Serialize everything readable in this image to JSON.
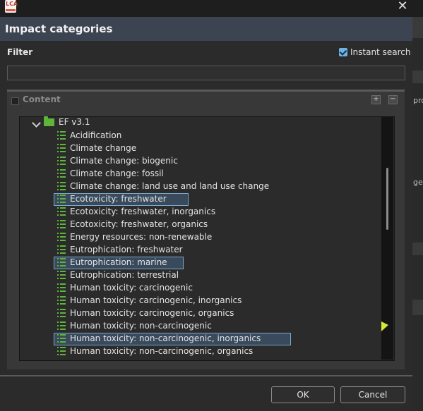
{
  "window": {
    "title": "Impact categories",
    "close_glyph": "✕",
    "app_icon": "lca-logo-icon",
    "app_icon_text": "LCA"
  },
  "filter": {
    "label": "Filter",
    "instant_search_label": "Instant search",
    "instant_search_checked": true,
    "value": ""
  },
  "content": {
    "title": "Content",
    "expand_glyph": "+",
    "collapse_glyph": "−",
    "folder": "EF v3.1",
    "items": [
      {
        "label": "Acidification",
        "selected": false
      },
      {
        "label": "Climate change",
        "selected": false
      },
      {
        "label": "Climate change: biogenic",
        "selected": false
      },
      {
        "label": "Climate change: fossil",
        "selected": false
      },
      {
        "label": "Climate change: land use and land use change",
        "selected": false
      },
      {
        "label": "Ecotoxicity: freshwater",
        "selected": true
      },
      {
        "label": "Ecotoxicity: freshwater, inorganics",
        "selected": false
      },
      {
        "label": "Ecotoxicity: freshwater, organics",
        "selected": false
      },
      {
        "label": "Energy resources: non-renewable",
        "selected": false
      },
      {
        "label": "Eutrophication: freshwater",
        "selected": false
      },
      {
        "label": "Eutrophication: marine",
        "selected": true
      },
      {
        "label": "Eutrophication: terrestrial",
        "selected": false
      },
      {
        "label": "Human toxicity: carcinogenic",
        "selected": false
      },
      {
        "label": "Human toxicity: carcinogenic, inorganics",
        "selected": false
      },
      {
        "label": "Human toxicity: carcinogenic, organics",
        "selected": false
      },
      {
        "label": "Human toxicity: non-carcinogenic",
        "selected": false
      },
      {
        "label": "Human toxicity: non-carcinogenic, inorganics",
        "selected": true
      },
      {
        "label": "Human toxicity: non-carcinogenic, organics",
        "selected": false
      }
    ]
  },
  "buttons": {
    "ok": "OK",
    "cancel": "Cancel"
  },
  "background_fragments": [
    "pro",
    "ge"
  ],
  "colors": {
    "header_bg": "#3d4451",
    "selection_border": "#7aa8c8",
    "icon_green": "#5fb53a",
    "checkbox": "#6cb4e8"
  }
}
